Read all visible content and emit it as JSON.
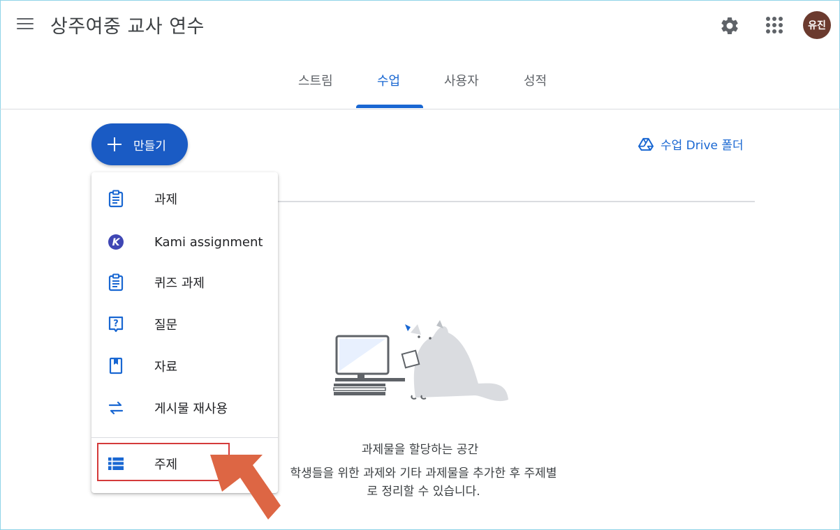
{
  "header": {
    "class_title": "상주여중 교사 연수",
    "avatar_text": "유진"
  },
  "tabs": [
    {
      "label": "스트림",
      "active": false
    },
    {
      "label": "수업",
      "active": true
    },
    {
      "label": "사용자",
      "active": false
    },
    {
      "label": "성적",
      "active": false
    }
  ],
  "create_button": {
    "label": "만들기"
  },
  "drive_link": {
    "label": "수업 Drive 폴더"
  },
  "menu": {
    "items": [
      {
        "label": "과제",
        "icon": "assignment-icon"
      },
      {
        "label": "Kami assignment",
        "icon": "kami-icon"
      },
      {
        "label": "퀴즈 과제",
        "icon": "quiz-assignment-icon"
      },
      {
        "label": "질문",
        "icon": "question-icon"
      },
      {
        "label": "자료",
        "icon": "material-icon"
      },
      {
        "label": "게시물 재사용",
        "icon": "reuse-post-icon"
      },
      {
        "label": "주제",
        "icon": "topic-icon"
      }
    ]
  },
  "empty_state": {
    "title": "과제물을 할당하는 공간",
    "desc_line1": "학생들을 위한 과제와 기타 과제물을 추가한 후 주제별",
    "desc_line2": "로 정리할 수 있습니다."
  },
  "colors": {
    "accent": "#1967d2",
    "create_button": "#1a5bc4",
    "annotation_red": "#d43a3a",
    "annotation_arrow": "#dd6644"
  }
}
